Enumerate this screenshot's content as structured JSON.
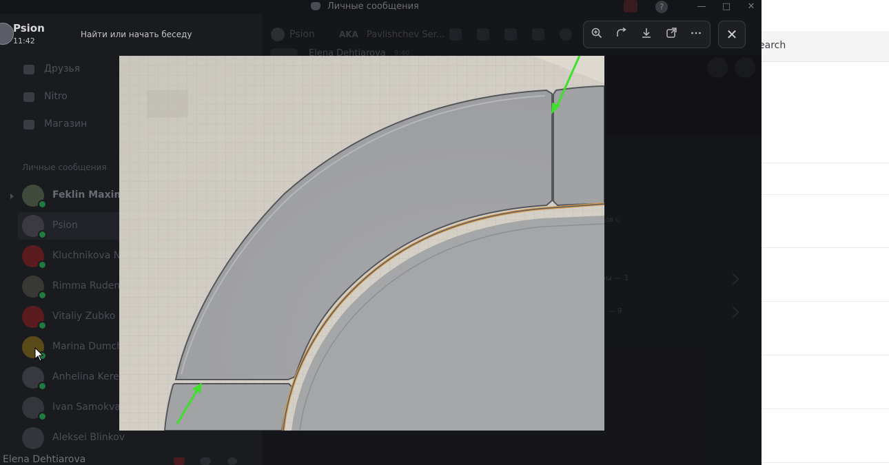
{
  "titlebar": {
    "title": "Личные сообщения"
  },
  "right_panel": {
    "search_text": "earch"
  },
  "user": {
    "name": "Psion",
    "time": "11:42",
    "bottom_name": "Elena Dehtiarova"
  },
  "search": {
    "placeholder": "Найти или начать беседу"
  },
  "nav": [
    {
      "label": "Друзья",
      "icon": "friends-icon"
    },
    {
      "label": "Nitro",
      "icon": "nitro-icon"
    },
    {
      "label": "Магазин",
      "icon": "shop-icon"
    }
  ],
  "dm_header": "Личные сообщения",
  "dms": [
    {
      "name": "Feklin Maxim",
      "color": "#3f4a3c"
    },
    {
      "name": "Psion",
      "color": "#3b3a40"
    },
    {
      "name": "Kluchnikova N",
      "color": "#5a1a1e"
    },
    {
      "name": "Rimma Ruden",
      "color": "#3a3835"
    },
    {
      "name": "Vitaliy Zubko",
      "color": "#5a1a1e"
    },
    {
      "name": "Marina Dumch",
      "color": "#5a4a1a"
    },
    {
      "name": "Anhelina Kere",
      "color": "#383a3f"
    },
    {
      "name": "Ivan Samokva",
      "color": "#34363b"
    },
    {
      "name": "Aleksei Blinkov",
      "color": "#33353a"
    }
  ],
  "chat": {
    "name": "Psion",
    "aka": "AKA",
    "aka_name": "Pavlishchev Ser...",
    "author": "Elena Dehtiarova",
    "time": "9:40"
  },
  "profile_fragments": [
    "ков с",
    "г",
    "ры — 1",
    "s — 9"
  ],
  "viewer": {
    "toolbar": [
      "zoom-in-icon",
      "rotate-icon",
      "download-icon",
      "open-external-icon",
      "more-icon"
    ],
    "close": "✕"
  },
  "colors": {
    "arrow": "#3de02a",
    "seam_glow": "#d49a4f",
    "tile": "#a3a4a6"
  }
}
